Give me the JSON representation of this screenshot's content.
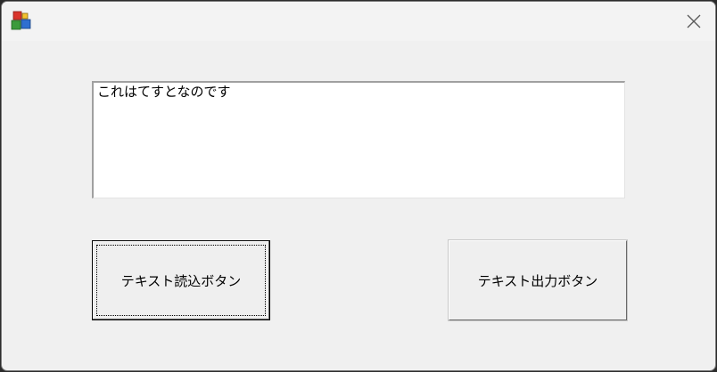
{
  "window": {
    "icon": "app-cubes-icon",
    "close_icon": "close-icon"
  },
  "textbox": {
    "value": "これはてすとなのです"
  },
  "buttons": {
    "read_label": "テキスト読込ボタン",
    "write_label": "テキスト出力ボタン"
  }
}
